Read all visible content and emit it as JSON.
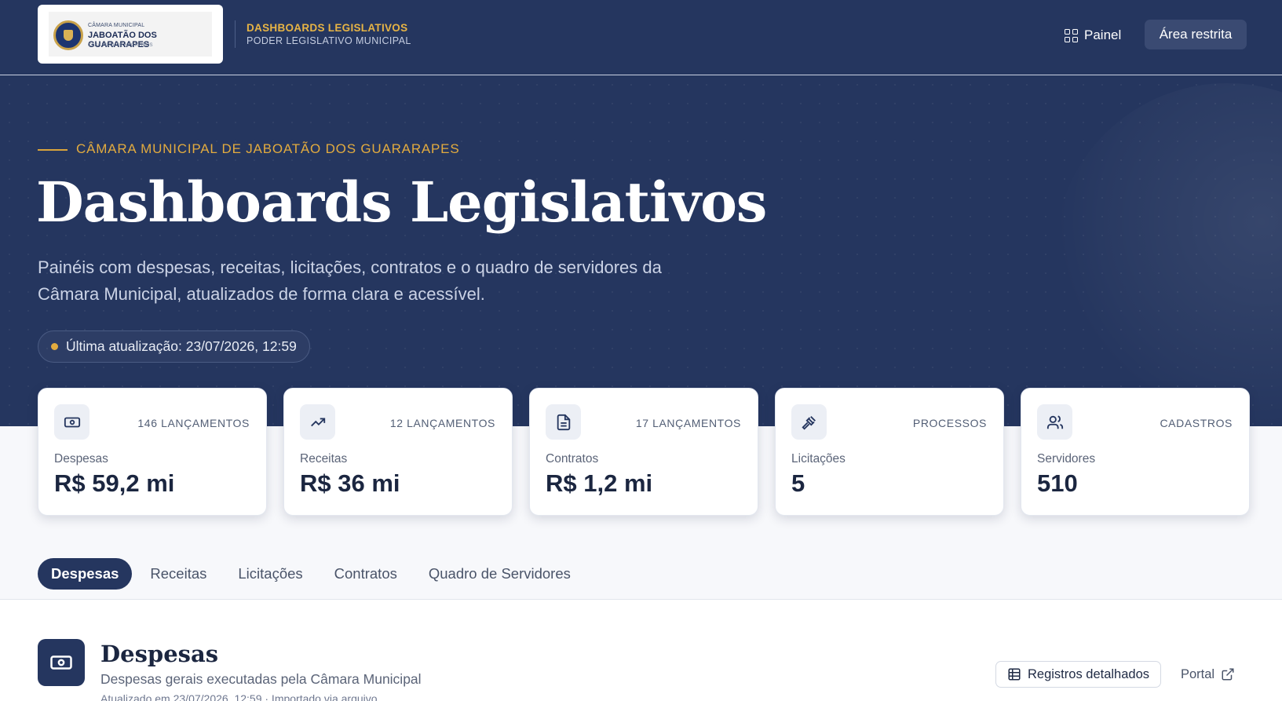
{
  "header": {
    "logo": {
      "small_text": "CÂMARA MUNICIPAL",
      "main_text": "JABOATÃO DOS GUARARAPES",
      "sub_text": "CASA VIDAL DE NEGREIROS"
    },
    "brand_title": "DASHBOARDS LEGISLATIVOS",
    "brand_subtitle": "PODER LEGISLATIVO MUNICIPAL",
    "nav": {
      "painel": "Painel",
      "restrita": "Área restrita"
    }
  },
  "hero": {
    "eyebrow": "CÂMARA MUNICIPAL DE JABOATÃO DOS GUARARAPES",
    "title": "Dashboards Legislativos",
    "description": "Painéis com despesas, receitas, licitações, contratos e o quadro de servidores da Câmara Municipal, atualizados de forma clara e acessível.",
    "last_update": "Última atualização: 23/07/2026, 12:59"
  },
  "cards": [
    {
      "icon": "money-icon",
      "badge": "146 LANÇAMENTOS",
      "label": "Despesas",
      "value": "R$ 59,2 mi"
    },
    {
      "icon": "trending-up-icon",
      "badge": "12 LANÇAMENTOS",
      "label": "Receitas",
      "value": "R$ 36 mi"
    },
    {
      "icon": "document-icon",
      "badge": "17 LANÇAMENTOS",
      "label": "Contratos",
      "value": "R$ 1,2 mi"
    },
    {
      "icon": "gavel-icon",
      "badge": "PROCESSOS",
      "label": "Licitações",
      "value": "5"
    },
    {
      "icon": "users-icon",
      "badge": "CADASTROS",
      "label": "Servidores",
      "value": "510"
    }
  ],
  "tabs": [
    {
      "label": "Despesas",
      "active": true
    },
    {
      "label": "Receitas",
      "active": false
    },
    {
      "label": "Licitações",
      "active": false
    },
    {
      "label": "Contratos",
      "active": false
    },
    {
      "label": "Quadro de Servidores",
      "active": false
    }
  ],
  "section": {
    "title": "Despesas",
    "description": "Despesas gerais executadas pela Câmara Municipal",
    "meta": "Atualizado em 23/07/2026, 12:59 · Importado via arquivo",
    "registros_label": "Registros detalhados",
    "portal_label": "Portal"
  },
  "colors": {
    "navy": "#25365f",
    "gold": "#e2ab3f",
    "background": "#f7f8fb"
  }
}
